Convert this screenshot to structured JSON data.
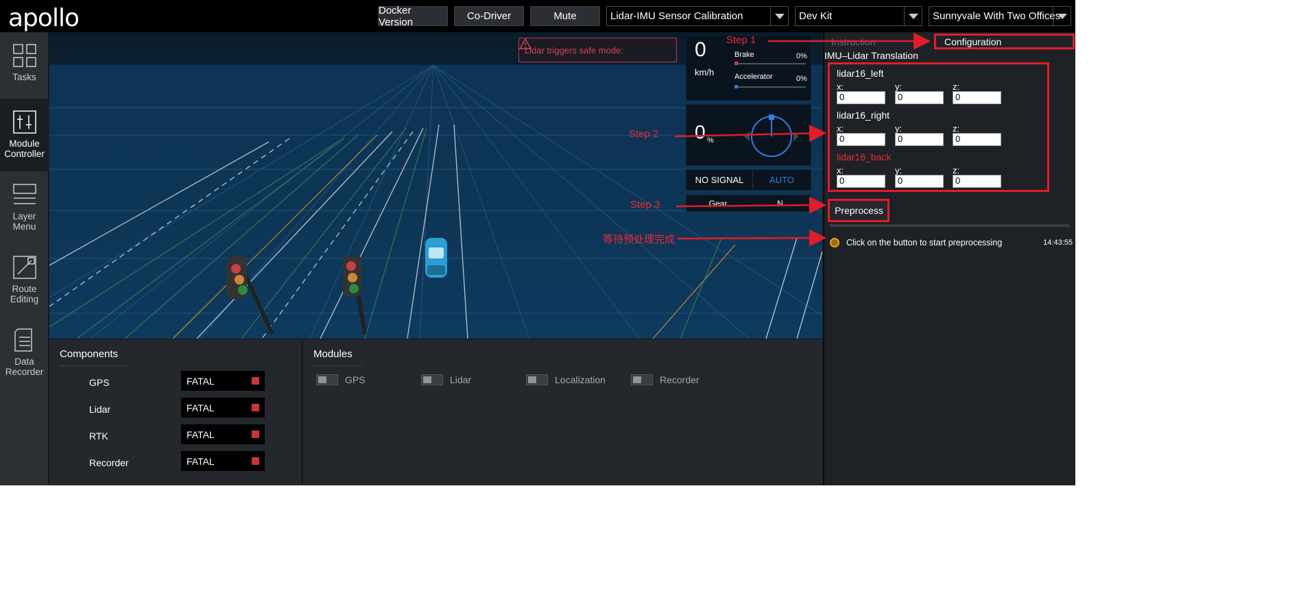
{
  "app": {
    "logo": "apollo"
  },
  "toolbar": {
    "docker_version": "Docker Version",
    "co_driver": "Co-Driver",
    "mute": "Mute",
    "mode_select": "Lidar-IMU Sensor Calibration",
    "vehicle_select": "Dev Kit",
    "map_select": "Sunnyvale With Two Offices"
  },
  "sidebar": {
    "items": [
      {
        "label": "Tasks",
        "icon": "grid-icon"
      },
      {
        "label": "Module Controller",
        "icon": "sliders-icon"
      },
      {
        "label": "Layer Menu",
        "icon": "layers-icon"
      },
      {
        "label": "Route Editing",
        "icon": "route-icon"
      },
      {
        "label": "Data Recorder",
        "icon": "recorder-icon"
      }
    ]
  },
  "alert": {
    "text": "Lidar triggers safe mode:"
  },
  "dashboard": {
    "speed": "0",
    "speed_unit": "km/h",
    "brake_label": "Brake",
    "brake_value": "0%",
    "accel_label": "Accelerator",
    "accel_value": "0%",
    "steering_value": "0",
    "steering_unit": "%",
    "signal": "NO SIGNAL",
    "drive_mode": "AUTO",
    "gear_label": "Gear",
    "gear_value": "N"
  },
  "components": {
    "title": "Components",
    "items": [
      {
        "name": "GPS",
        "status": "FATAL"
      },
      {
        "name": "Lidar",
        "status": "FATAL"
      },
      {
        "name": "RTK",
        "status": "FATAL"
      },
      {
        "name": "Recorder",
        "status": "FATAL"
      }
    ]
  },
  "modules": {
    "title": "Modules",
    "items": [
      "GPS",
      "Lidar",
      "Localization",
      "Recorder"
    ]
  },
  "calibration": {
    "tab_instruction": "Instruction",
    "tab_configuration": "Configuration",
    "section_title": "IMU–Lidar Translation",
    "sensors": [
      {
        "name": "lidar16_left",
        "x": "0",
        "y": "0",
        "z": "0"
      },
      {
        "name": "lidar16_right",
        "x": "0",
        "y": "0",
        "z": "0"
      },
      {
        "name": "lidar16_back",
        "x": "0",
        "y": "0",
        "z": "0"
      }
    ],
    "axis_x": "x:",
    "axis_y": "y:",
    "axis_z": "z:",
    "preprocess_button": "Preprocess",
    "log_message": "Click on the button to start preprocessing",
    "log_time": "14:43:55"
  },
  "annotations": {
    "step1": "Step 1",
    "step2": "Step 2",
    "step3": "Step 3",
    "wait": "等待预处理完成"
  },
  "colors": {
    "annotation_red": "#e11d2a",
    "fatal_red": "#c8353f",
    "auto_blue": "#2f7fe0",
    "scene_blue": "#0d3555"
  }
}
